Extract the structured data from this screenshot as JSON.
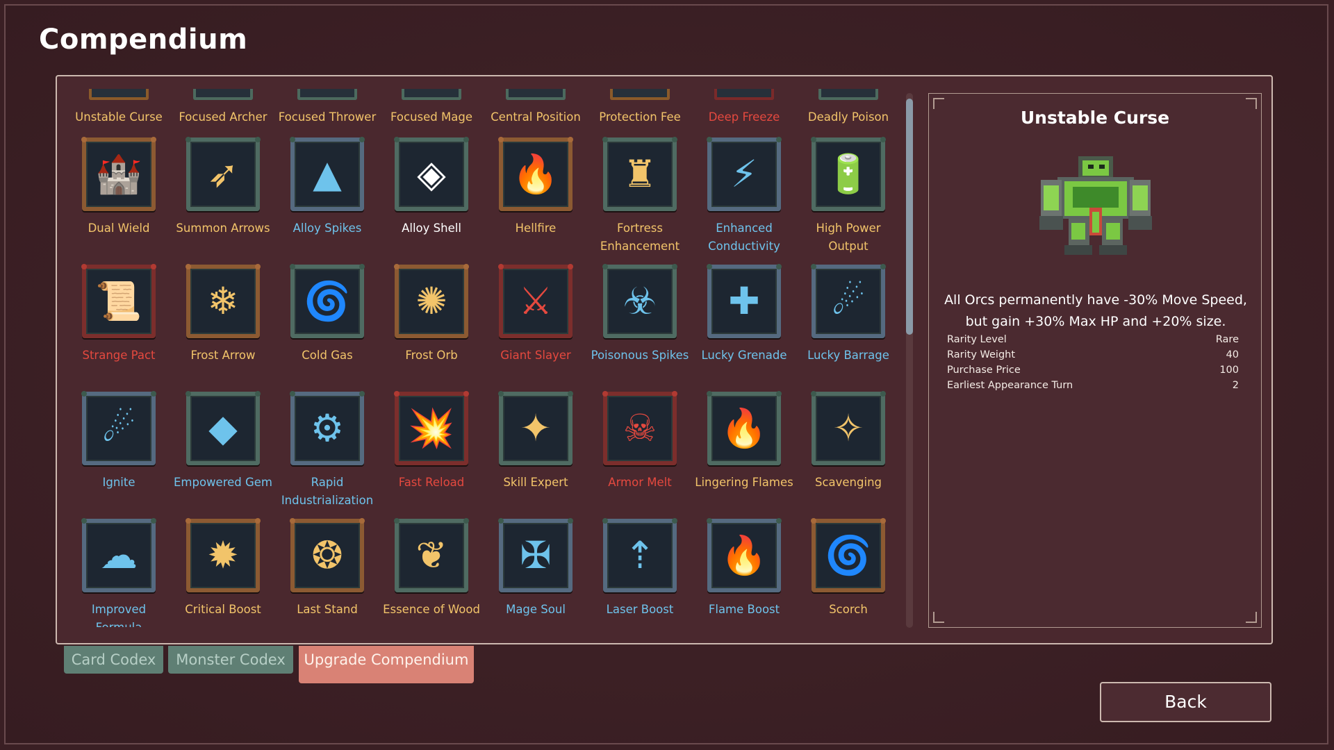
{
  "window": {
    "title": "Compendium"
  },
  "top_row": [
    {
      "label": "Unstable Curse",
      "color": "gold",
      "frame": "gold"
    },
    {
      "label": "Focused Archer",
      "color": "gold",
      "frame": "green"
    },
    {
      "label": "Focused Thrower",
      "color": "gold",
      "frame": "green"
    },
    {
      "label": "Focused Mage",
      "color": "gold",
      "frame": "green"
    },
    {
      "label": "Central Position",
      "color": "gold",
      "frame": "green"
    },
    {
      "label": "Protection Fee",
      "color": "gold",
      "frame": "gold"
    },
    {
      "label": "Deep Freeze",
      "color": "red",
      "frame": "red"
    },
    {
      "label": "Deadly Poison",
      "color": "gold",
      "frame": "green"
    }
  ],
  "rows": [
    [
      {
        "label": "Dual Wield",
        "color": "gold",
        "frame": "gold",
        "icon": "tower-crossbow-icon",
        "glyph": "🏰"
      },
      {
        "label": "Summon Arrows",
        "color": "gold",
        "frame": "green",
        "icon": "arrow-burst-icon",
        "glyph": "➶"
      },
      {
        "label": "Alloy Spikes",
        "color": "blue",
        "frame": "blue",
        "icon": "metal-spike-icon",
        "glyph": "▲"
      },
      {
        "label": "Alloy Shell",
        "color": "white",
        "frame": "green",
        "icon": "shield-shell-icon",
        "glyph": "◈"
      },
      {
        "label": "Hellfire",
        "color": "gold",
        "frame": "gold",
        "icon": "fire-demon-icon",
        "glyph": "🔥"
      },
      {
        "label": "Fortress Enhancement",
        "color": "gold",
        "frame": "green",
        "icon": "fortress-tower-icon",
        "glyph": "♜"
      },
      {
        "label": "Enhanced Conductivity",
        "color": "blue",
        "frame": "blue",
        "icon": "crossed-lightning-icon",
        "glyph": "⚡"
      },
      {
        "label": "High Power Output",
        "color": "gold",
        "frame": "green",
        "icon": "energy-battery-icon",
        "glyph": "🔋"
      }
    ],
    [
      {
        "label": "Strange Pact",
        "color": "red",
        "frame": "red",
        "icon": "contract-scroll-icon",
        "glyph": "📜"
      },
      {
        "label": "Frost Arrow",
        "color": "gold",
        "frame": "gold",
        "icon": "frost-arrow-icon",
        "glyph": "❄"
      },
      {
        "label": "Cold Gas",
        "color": "gold",
        "frame": "green",
        "icon": "gas-vortex-icon",
        "glyph": "🌀"
      },
      {
        "label": "Frost Orb",
        "color": "gold",
        "frame": "gold",
        "icon": "frost-orb-icon",
        "glyph": "✺"
      },
      {
        "label": "Giant Slayer",
        "color": "red",
        "frame": "red",
        "icon": "slayer-silhouette-icon",
        "glyph": "⚔"
      },
      {
        "label": "Poisonous Spikes",
        "color": "blue",
        "frame": "green",
        "icon": "poison-spikes-icon",
        "glyph": "☣"
      },
      {
        "label": "Lucky Grenade",
        "color": "blue",
        "frame": "blue",
        "icon": "grenade-canister-icon",
        "glyph": "✚"
      },
      {
        "label": "Lucky Barrage",
        "color": "blue",
        "frame": "blue",
        "icon": "fire-barrage-icon",
        "glyph": "☄"
      }
    ],
    [
      {
        "label": "Ignite",
        "color": "blue",
        "frame": "blue",
        "icon": "ignite-fireball-icon",
        "glyph": "☄"
      },
      {
        "label": "Empowered Gem",
        "color": "blue",
        "frame": "green",
        "icon": "blue-gem-icon",
        "glyph": "◆"
      },
      {
        "label": "Rapid Industrialization",
        "color": "blue",
        "frame": "blue",
        "icon": "barrel-gear-icon",
        "glyph": "⚙"
      },
      {
        "label": "Fast Reload",
        "color": "red",
        "frame": "red",
        "icon": "cannon-icon",
        "glyph": "💥"
      },
      {
        "label": "Skill Expert",
        "color": "gold",
        "frame": "green",
        "icon": "rainbow-scroll-icon",
        "glyph": "✦"
      },
      {
        "label": "Armor Melt",
        "color": "red",
        "frame": "red",
        "icon": "acid-golem-icon",
        "glyph": "☠"
      },
      {
        "label": "Lingering Flames",
        "color": "gold",
        "frame": "green",
        "icon": "flame-ring-icon",
        "glyph": "🔥"
      },
      {
        "label": "Scavenging",
        "color": "gold",
        "frame": "green",
        "icon": "sparkle-skull-icon",
        "glyph": "✧"
      }
    ],
    [
      {
        "label": "Improved Formula",
        "color": "blue",
        "frame": "blue",
        "icon": "poison-cloud-icon",
        "glyph": "☁"
      },
      {
        "label": "Critical Boost",
        "color": "gold",
        "frame": "gold",
        "icon": "critical-burst-icon",
        "glyph": "✹"
      },
      {
        "label": "Last Stand",
        "color": "gold",
        "frame": "gold",
        "icon": "crystal-dome-icon",
        "glyph": "❂"
      },
      {
        "label": "Essence of Wood",
        "color": "gold",
        "frame": "green",
        "icon": "wood-block-icon",
        "glyph": "❦"
      },
      {
        "label": "Mage Soul",
        "color": "blue",
        "frame": "blue",
        "icon": "mage-staff-icon",
        "glyph": "✠"
      },
      {
        "label": "Laser Boost",
        "color": "blue",
        "frame": "blue",
        "icon": "laser-beam-icon",
        "glyph": "⇡"
      },
      {
        "label": "Flame Boost",
        "color": "blue",
        "frame": "blue",
        "icon": "flame-pillar-icon",
        "glyph": "🔥"
      },
      {
        "label": "Scorch",
        "color": "gold",
        "frame": "gold",
        "icon": "fire-vortex-icon",
        "glyph": "🌀"
      }
    ]
  ],
  "detail": {
    "title": "Unstable Curse",
    "art_icon": "green-orc-golem-icon",
    "description": "All Orcs permanently have -30% Move Speed, but gain +30% Max HP and +20% size.",
    "stats": [
      {
        "key": "Rarity Level",
        "value": "Rare"
      },
      {
        "key": "Rarity Weight",
        "value": "40"
      },
      {
        "key": "Purchase Price",
        "value": "100"
      },
      {
        "key": "Earliest Appearance Turn",
        "value": "2"
      }
    ]
  },
  "tabs": [
    {
      "label": "Card Codex",
      "active": false
    },
    {
      "label": "Monster Codex",
      "active": false
    },
    {
      "label": "Upgrade Compendium",
      "active": true
    }
  ],
  "back_button": {
    "label": "Back"
  },
  "scroll": {
    "position_fraction": 0.0,
    "visible_fraction": 0.45
  },
  "colors": {
    "gold": "#f2c46a",
    "blue": "#6ec3ec",
    "red": "#e5493f",
    "active_tab": "#d98275",
    "inactive_tab": "#5f7f74"
  }
}
